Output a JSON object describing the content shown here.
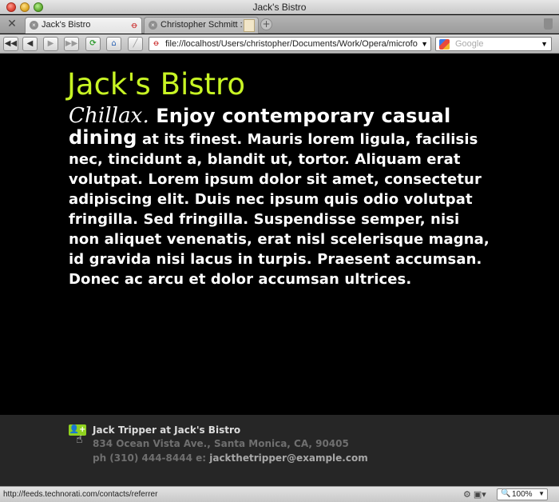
{
  "window": {
    "title": "Jack's Bistro"
  },
  "tabs": [
    {
      "label": "Jack's Bistro",
      "active": true
    },
    {
      "label": "Christopher Schmitt : ...",
      "active": false
    }
  ],
  "toolbar": {
    "address": "file://localhost/Users/christopher/Documents/Work/Opera/microfo",
    "search_placeholder": "Google"
  },
  "page": {
    "title": "Jack's Bistro",
    "lead_em": "Chillax.",
    "lead_rest": " Enjoy contemporary casual dining",
    "body": " at its finest. Mauris lorem ligula, facilisis nec, tincidunt a, blandit ut, tortor. Aliquam erat volutpat. Lorem ipsum dolor sit amet, consectetur adipiscing elit. Duis nec ipsum quis odio volutpat fringilla. Sed fringilla. Suspendisse semper, nisi non aliquet venenatis, erat nisl scelerisque magna, id gravida nisi lacus in turpis. Praesent accumsan. Donec ac arcu et dolor accumsan ultrices."
  },
  "vcard": {
    "name": "Jack Tripper at Jack's Bistro",
    "address": "834 Ocean Vista Ave., Santa Monica, CA, 90405",
    "phone_prefix": "ph (310) 444-8444 e: ",
    "email": "jackthetripper@example.com",
    "icon": "vcard-add-icon"
  },
  "status": {
    "url": "http://feeds.technorati.com/contacts/referrer",
    "zoom": "100%"
  },
  "colors": {
    "title_green": "#c8f524",
    "vcard_icon": "#8fd11f",
    "page_bg": "#000000",
    "footer_bg": "#262626"
  }
}
